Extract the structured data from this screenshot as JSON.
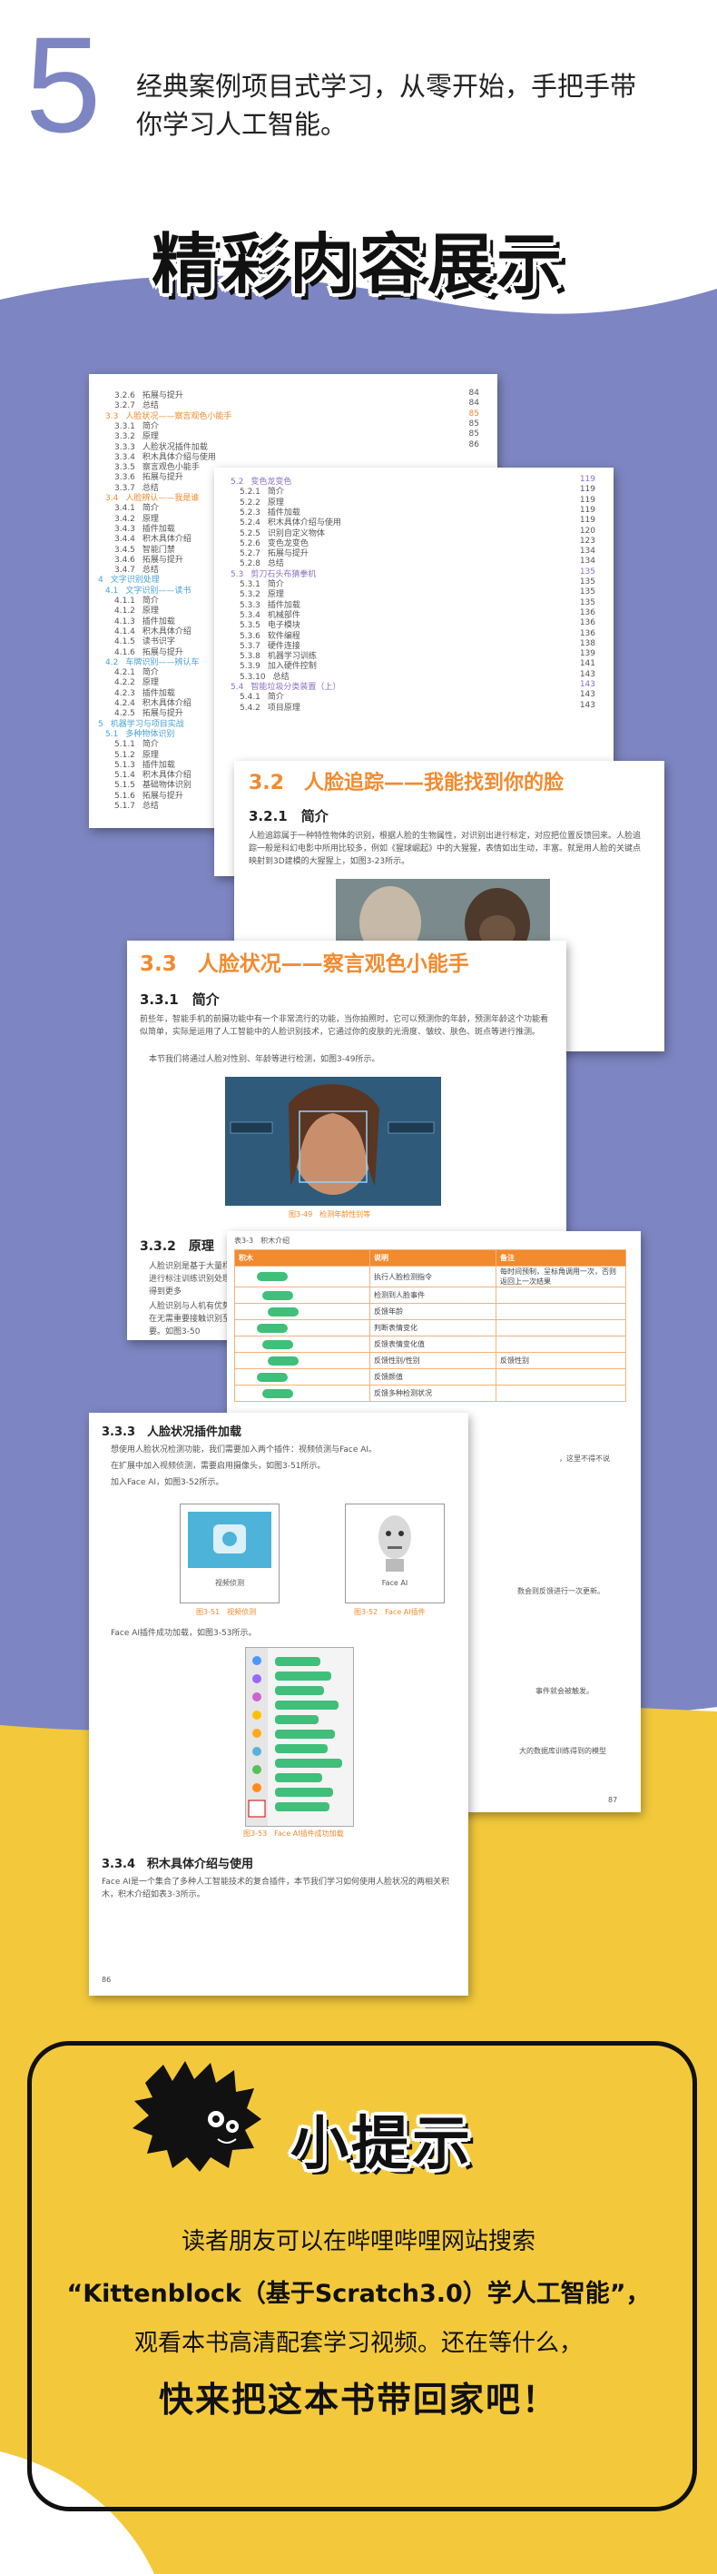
{
  "header": {
    "number": "5",
    "line1": "经典案例项目式学习，从零开始，手把手带",
    "line2": "你学习人工智能。"
  },
  "showcase": {
    "title": "精彩内容展示"
  },
  "colors": {
    "band_purple": "#7d86c2",
    "band_yellow": "#f3c93b",
    "accent_orange": "#f28a2e",
    "toc_blue": "#4aa3d8",
    "toc_purple": "#8a6fc4"
  },
  "page1_toc": {
    "rows": [
      {
        "num": "3.2.6",
        "text": "拓展与提升",
        "page": "84"
      },
      {
        "num": "3.2.7",
        "text": "总结",
        "page": "84"
      },
      {
        "num": "3.3",
        "text": "人脸状况——察言观色小能手",
        "page": "85"
      },
      {
        "num": "3.3.1",
        "text": "简介",
        "page": "85"
      },
      {
        "num": "3.3.2",
        "text": "原理",
        "page": "85"
      },
      {
        "num": "3.3.3",
        "text": "人脸状况插件加载",
        "page": "86"
      },
      {
        "num": "3.3.4",
        "text": "积木具体介绍与使用",
        "page": ""
      },
      {
        "num": "3.3.5",
        "text": "察言观色小能手",
        "page": ""
      },
      {
        "num": "3.3.6",
        "text": "拓展与提升",
        "page": ""
      },
      {
        "num": "3.3.7",
        "text": "总结",
        "page": ""
      },
      {
        "num": "3.4",
        "text": "人脸辨认——我是谁",
        "page": ""
      },
      {
        "num": "3.4.1",
        "text": "简介",
        "page": ""
      },
      {
        "num": "3.4.2",
        "text": "原理",
        "page": ""
      },
      {
        "num": "3.4.3",
        "text": "插件加载",
        "page": ""
      },
      {
        "num": "3.4.4",
        "text": "积木具体介绍",
        "page": ""
      },
      {
        "num": "3.4.5",
        "text": "智能门禁",
        "page": ""
      },
      {
        "num": "3.4.6",
        "text": "拓展与提升",
        "page": ""
      },
      {
        "num": "3.4.7",
        "text": "总结",
        "page": ""
      },
      {
        "num": "4",
        "text": "文字识别处理",
        "page": ""
      },
      {
        "num": "4.1",
        "text": "文字识别——读书",
        "page": ""
      },
      {
        "num": "4.1.1",
        "text": "简介",
        "page": ""
      },
      {
        "num": "4.1.2",
        "text": "原理",
        "page": ""
      },
      {
        "num": "4.1.3",
        "text": "插件加载",
        "page": ""
      },
      {
        "num": "4.1.4",
        "text": "积木具体介绍",
        "page": ""
      },
      {
        "num": "4.1.5",
        "text": "读书识字",
        "page": ""
      },
      {
        "num": "4.1.6",
        "text": "拓展与提升",
        "page": ""
      },
      {
        "num": "4.2",
        "text": "车牌识别——辨认车",
        "page": ""
      },
      {
        "num": "4.2.1",
        "text": "简介",
        "page": ""
      },
      {
        "num": "4.2.2",
        "text": "原理",
        "page": ""
      },
      {
        "num": "4.2.3",
        "text": "插件加载",
        "page": ""
      },
      {
        "num": "4.2.4",
        "text": "积木具体介绍",
        "page": ""
      },
      {
        "num": "4.2.5",
        "text": "拓展与提升",
        "page": ""
      },
      {
        "num": "5",
        "text": "机器学习与项目实战",
        "page": ""
      },
      {
        "num": "5.1",
        "text": "多种物体识别",
        "page": ""
      },
      {
        "num": "5.1.1",
        "text": "简介",
        "page": ""
      },
      {
        "num": "5.1.2",
        "text": "原理",
        "page": ""
      },
      {
        "num": "5.1.3",
        "text": "插件加载",
        "page": ""
      },
      {
        "num": "5.1.4",
        "text": "积木具体介绍",
        "page": ""
      },
      {
        "num": "5.1.5",
        "text": "基础物体识别",
        "page": ""
      },
      {
        "num": "5.1.6",
        "text": "拓展与提升",
        "page": ""
      },
      {
        "num": "5.1.7",
        "text": "总结",
        "page": ""
      }
    ]
  },
  "page2_toc": {
    "rows": [
      {
        "num": "5.2",
        "text": "变色龙变色",
        "page": "119"
      },
      {
        "num": "5.2.1",
        "text": "简介",
        "page": "119"
      },
      {
        "num": "5.2.2",
        "text": "原理",
        "page": "119"
      },
      {
        "num": "5.2.3",
        "text": "插件加载",
        "page": "119"
      },
      {
        "num": "5.2.4",
        "text": "积木具体介绍与使用",
        "page": "119"
      },
      {
        "num": "5.2.5",
        "text": "识别自定义物体",
        "page": "120"
      },
      {
        "num": "5.2.6",
        "text": "变色龙变色",
        "page": "123"
      },
      {
        "num": "5.2.7",
        "text": "拓展与提升",
        "page": "134"
      },
      {
        "num": "5.2.8",
        "text": "总结",
        "page": "134"
      },
      {
        "num": "5.3",
        "text": "剪刀石头布猜拳机",
        "page": "135"
      },
      {
        "num": "5.3.1",
        "text": "简介",
        "page": "135"
      },
      {
        "num": "5.3.2",
        "text": "原理",
        "page": "135"
      },
      {
        "num": "5.3.3",
        "text": "插件加载",
        "page": "135"
      },
      {
        "num": "5.3.4",
        "text": "机械部件",
        "page": "136"
      },
      {
        "num": "5.3.5",
        "text": "电子模块",
        "page": "136"
      },
      {
        "num": "5.3.6",
        "text": "软件编程",
        "page": "136"
      },
      {
        "num": "5.3.7",
        "text": "硬件连接",
        "page": "138"
      },
      {
        "num": "5.3.8",
        "text": "机器学习训练",
        "page": "139"
      },
      {
        "num": "5.3.9",
        "text": "加入硬件控制",
        "page": "141"
      },
      {
        "num": "5.3.10",
        "text": "总结",
        "page": "143"
      },
      {
        "num": "5.4",
        "text": "智能垃圾分类装置（上）",
        "page": "143"
      },
      {
        "num": "5.4.1",
        "text": "简介",
        "page": "143"
      },
      {
        "num": "5.4.2",
        "text": "项目原理",
        "page": "143"
      }
    ]
  },
  "page3": {
    "section": "3.2　人脸追踪——我能找到你的脸",
    "subsection": "3.2.1　简介",
    "para": "人脸追踪属于一种特性物体的识别，根据人脸的生物属性，对识别出进行标定，对应把位置反馈回来。人脸追踪一般是科幻电影中所用比较多，例如《猩球崛起》中的大猩猩，表情如出生动，丰富。就是用人脸的关键点映射到3D建模的大猩猩上，如图3-23所示。"
  },
  "page4": {
    "section": "3.3　人脸状况——察言观色小能手",
    "subsection": "3.3.1　简介",
    "para1": "前些年，智能手机的前摄功能中有一个非常流行的功能，当你拍照时，它可以预测你的年龄，预测年龄这个功能看似简单，实际是运用了人工智能中的人脸识别技术，它通过你的皮肤的光滑度、皱纹、肤色、斑点等进行推测。",
    "para2": "本节我们将通过人脸对性别、年龄等进行检测，如图3-49所示。",
    "caption": "图3-49　检测年龄性别等",
    "cut_sub": "3.3.2　原理",
    "cut_para1": "人脸识别是基于大量样本进行标注训练识别处理，得到更多",
    "cut_para2": "人脸识别与人机有优势。在无需重要接触识别至重要。如图3-50"
  },
  "page5": {
    "table_title": "表3-3　积木介绍",
    "headers": [
      "积木",
      "说明",
      "备注"
    ],
    "rows": [
      [
        "",
        "执行人脸检测指令",
        "每时间预制，呈标角调用一次，否则返回上一次结果"
      ],
      [
        "",
        "检测到人脸事件",
        ""
      ],
      [
        "",
        "反馈年龄",
        ""
      ],
      [
        "",
        "判断表情变化",
        ""
      ],
      [
        "",
        "反馈表情变化值",
        ""
      ],
      [
        "",
        "反馈性别/性别",
        "反馈性别"
      ],
      [
        "",
        "反馈颜值",
        ""
      ],
      [
        "",
        "反馈多种检测状况",
        ""
      ]
    ],
    "tail1": "，这里不得不说",
    "tail2": "数会则反馈进行一次更新。",
    "tail3": "事件就会被触发。",
    "tail4": "大的数据库训练得到的模型",
    "page_no": "87"
  },
  "page6": {
    "subsection": "3.3.3　人脸状况插件加载",
    "para1": "想使用人脸状况检测功能，我们需要加入两个插件：视频侦测与Face AI。",
    "para2": "在扩展中加入视频侦测，需要启用摄像头，如图3-51所示。",
    "para3": "加入Face AI，如图3-52所示。",
    "label_video": "视频侦测",
    "label_face": "Face AI",
    "cap1": "图3-51　视频侦测",
    "cap2": "图3-52　Face AI插件",
    "para4": "Face AI插件成功加载，如图3-53所示。",
    "cap3": "图3-53　Face AI插件成功加载",
    "subsection2": "3.3.4　积木具体介绍与使用",
    "para5": "Face AI是一个集合了多种人工智能技术的复合插件，本节我们学习如何使用人脸状况的两相关积木，积木介绍如表3-3所示。",
    "page_no": "86"
  },
  "tip": {
    "title": "小提示",
    "line1": "读者朋友可以在哔哩哔哩网站搜索",
    "line2": "“Kittenblock（基于Scratch3.0）学人工智能”，",
    "line3": "观看本书高清配套学习视频。还在等什么，",
    "line4": "快来把这本书带回家吧！"
  }
}
